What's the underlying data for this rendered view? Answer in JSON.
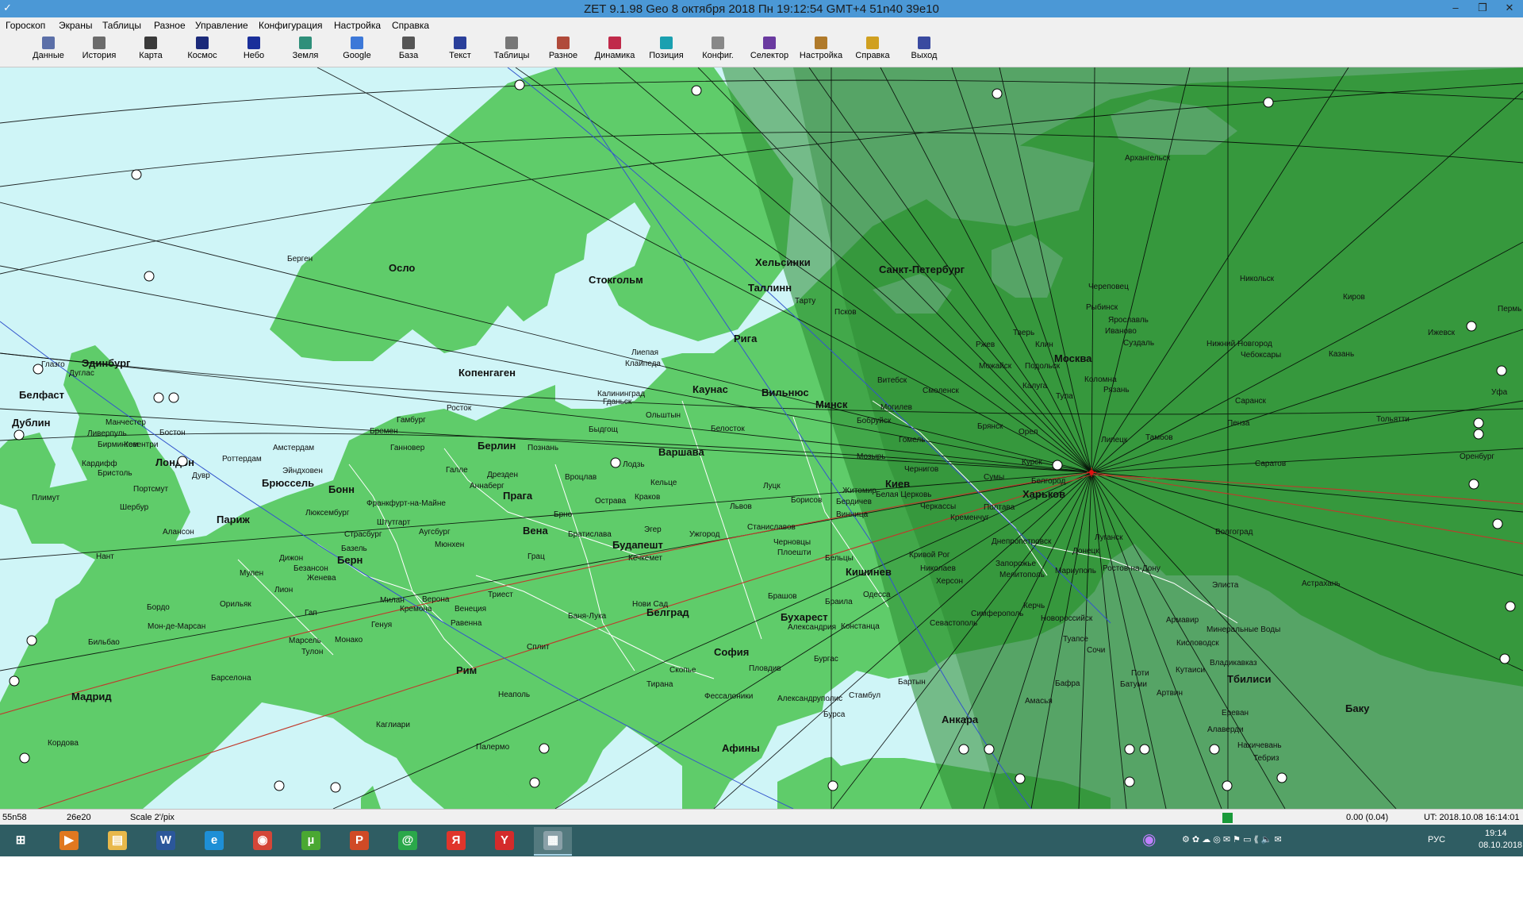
{
  "window": {
    "title": "ZET 9.1.98 Geo     8 октября 2018  Пн   19:12:54 GMT+4 51n40  39e10",
    "controls": [
      "–",
      "❐",
      "✕"
    ]
  },
  "menu": [
    "Гороскоп",
    "Экраны",
    "Таблицы",
    "Разное",
    "Управление",
    "Конфигурация",
    "Настройка",
    "Справка"
  ],
  "toolbar": [
    {
      "label": "Данные",
      "icon": "data-icon",
      "color": "#5b6fa8"
    },
    {
      "label": "История",
      "icon": "history-icon",
      "color": "#6b6b6b"
    },
    {
      "label": "Карта",
      "icon": "map-icon",
      "color": "#3a3a3a"
    },
    {
      "label": "Космос",
      "icon": "cosmos-icon",
      "color": "#1b2a7a"
    },
    {
      "label": "Небо",
      "icon": "sky-icon",
      "color": "#1a2f9a"
    },
    {
      "label": "Земля",
      "icon": "earth-icon",
      "color": "#2f8f7a"
    },
    {
      "label": "Google",
      "icon": "google-icon",
      "color": "#3c78d8"
    },
    {
      "label": "База",
      "icon": "database-icon",
      "color": "#555555"
    },
    {
      "label": "Текст",
      "icon": "text-icon",
      "color": "#2a3f9a"
    },
    {
      "label": "Таблицы",
      "icon": "tables-icon",
      "color": "#777777"
    },
    {
      "label": "Разное",
      "icon": "misc-icon",
      "color": "#b04a3a"
    },
    {
      "label": "Динамика",
      "icon": "dynamics-icon",
      "color": "#c02a4a"
    },
    {
      "label": "Позиция",
      "icon": "position-icon",
      "color": "#1aa0b0"
    },
    {
      "label": "Конфиг.",
      "icon": "config-icon",
      "color": "#888888"
    },
    {
      "label": "Селектор",
      "icon": "selector-icon",
      "color": "#6a3aa0"
    },
    {
      "label": "Настройка",
      "icon": "settings-icon",
      "color": "#b07a2a"
    },
    {
      "label": "Справка",
      "icon": "help-icon",
      "color": "#d0a020"
    },
    {
      "label": "Выход",
      "icon": "exit-icon",
      "color": "#3a4aa0"
    }
  ],
  "map": {
    "colors": {
      "sea": "#cff5f7",
      "land": "#5fcc6a",
      "land_shaded": "#2f9934",
      "land_dark": "#238a2c",
      "sea_shaded": "#a7d6d8",
      "line": "#000000",
      "ecliptic": "#c0392b",
      "equator": "#3355cc"
    },
    "cities": [
      {
        "name": "Архангельск",
        "b": false
      },
      {
        "name": "Берген",
        "b": false
      },
      {
        "name": "Осло",
        "b": true
      },
      {
        "name": "Стокгольм",
        "b": true
      },
      {
        "name": "Хельсинки",
        "b": true
      },
      {
        "name": "Санкт-Петербург",
        "b": true
      },
      {
        "name": "Таллинн",
        "b": true
      },
      {
        "name": "Тарту",
        "b": false
      },
      {
        "name": "Псков",
        "b": false
      },
      {
        "name": "Череповец",
        "b": false
      },
      {
        "name": "Никольск",
        "b": false
      },
      {
        "name": "Киров",
        "b": false
      },
      {
        "name": "Пермь",
        "b": false
      },
      {
        "name": "Рыбинск",
        "b": false
      },
      {
        "name": "Ярославль",
        "b": false
      },
      {
        "name": "Иваново",
        "b": false
      },
      {
        "name": "Эдинбург",
        "b": true
      },
      {
        "name": "Глазго",
        "b": false
      },
      {
        "name": "Дуглас",
        "b": false
      },
      {
        "name": "Белфаст",
        "b": true
      },
      {
        "name": "Дублин",
        "b": true
      },
      {
        "name": "Копенгаген",
        "b": true
      },
      {
        "name": "Рига",
        "b": true
      },
      {
        "name": "Лиепая",
        "b": false
      },
      {
        "name": "Клайпеда",
        "b": false
      },
      {
        "name": "Каунас",
        "b": true
      },
      {
        "name": "Вильнюс",
        "b": true
      },
      {
        "name": "Калининград",
        "b": false
      },
      {
        "name": "Гданьск",
        "b": false
      },
      {
        "name": "Тверь",
        "b": false
      },
      {
        "name": "Ржев",
        "b": false
      },
      {
        "name": "Клин",
        "b": false
      },
      {
        "name": "Суздаль",
        "b": false
      },
      {
        "name": "Нижний Новгород",
        "b": false
      },
      {
        "name": "Чебоксары",
        "b": false
      },
      {
        "name": "Ижевск",
        "b": false
      },
      {
        "name": "Казань",
        "b": false
      },
      {
        "name": "Москва",
        "b": true
      },
      {
        "name": "Подольск",
        "b": false
      },
      {
        "name": "Можайск",
        "b": false
      },
      {
        "name": "Коломна",
        "b": false
      },
      {
        "name": "Рязань",
        "b": false
      },
      {
        "name": "Калуга",
        "b": false
      },
      {
        "name": "Тула",
        "b": false
      },
      {
        "name": "Смоленск",
        "b": false
      },
      {
        "name": "Витебск",
        "b": false
      },
      {
        "name": "Минск",
        "b": true
      },
      {
        "name": "Могилев",
        "b": false
      },
      {
        "name": "Бобруйск",
        "b": false
      },
      {
        "name": "Брянск",
        "b": false
      },
      {
        "name": "Орел",
        "b": false
      },
      {
        "name": "Липецк",
        "b": false
      },
      {
        "name": "Тамбов",
        "b": false
      },
      {
        "name": "Саранск",
        "b": false
      },
      {
        "name": "Пенза",
        "b": false
      },
      {
        "name": "Тольятти",
        "b": false
      },
      {
        "name": "Уфа",
        "b": false
      },
      {
        "name": "Оренбург",
        "b": false
      },
      {
        "name": "Саратов",
        "b": false
      },
      {
        "name": "Курск",
        "b": false
      },
      {
        "name": "Белгород",
        "b": false
      },
      {
        "name": "Сумы",
        "b": false
      },
      {
        "name": "Гомель",
        "b": false
      },
      {
        "name": "Мозырь",
        "b": false
      },
      {
        "name": "Чернигов",
        "b": false
      },
      {
        "name": "Киев",
        "b": true
      },
      {
        "name": "Харьков",
        "b": true
      },
      {
        "name": "Полтава",
        "b": false
      },
      {
        "name": "Кременчуг",
        "b": false
      },
      {
        "name": "Черкассы",
        "b": false
      },
      {
        "name": "Белая Церковь",
        "b": false
      },
      {
        "name": "Житомир",
        "b": false
      },
      {
        "name": "Бердичев",
        "b": false
      },
      {
        "name": "Винница",
        "b": false
      },
      {
        "name": "Манчестер",
        "b": false
      },
      {
        "name": "Ливерпуль",
        "b": false
      },
      {
        "name": "Бирмингем",
        "b": false
      },
      {
        "name": "Ковентри",
        "b": false
      },
      {
        "name": "Бостон",
        "b": false
      },
      {
        "name": "Кардифф",
        "b": false
      },
      {
        "name": "Бристоль",
        "b": false
      },
      {
        "name": "Лондон",
        "b": true
      },
      {
        "name": "Дувр",
        "b": false
      },
      {
        "name": "Портсмут",
        "b": false
      },
      {
        "name": "Плимут",
        "b": false
      },
      {
        "name": "Шербур",
        "b": false
      },
      {
        "name": "Роттердам",
        "b": false
      },
      {
        "name": "Амстердам",
        "b": false
      },
      {
        "name": "Эйндховен",
        "b": false
      },
      {
        "name": "Брюссель",
        "b": true
      },
      {
        "name": "Бремен",
        "b": false
      },
      {
        "name": "Гамбург",
        "b": false
      },
      {
        "name": "Росток",
        "b": false
      },
      {
        "name": "Ганновер",
        "b": false
      },
      {
        "name": "Берлин",
        "b": true
      },
      {
        "name": "Познань",
        "b": false
      },
      {
        "name": "Быдгощ",
        "b": false
      },
      {
        "name": "Ольштын",
        "b": false
      },
      {
        "name": "Белосток",
        "b": false
      },
      {
        "name": "Варшава",
        "b": true
      },
      {
        "name": "Лодзь",
        "b": false
      },
      {
        "name": "Кельце",
        "b": false
      },
      {
        "name": "Краков",
        "b": false
      },
      {
        "name": "Вроцлав",
        "b": false
      },
      {
        "name": "Дрезден",
        "b": false
      },
      {
        "name": "Галле",
        "b": false
      },
      {
        "name": "Аннаберг",
        "b": false
      },
      {
        "name": "Прага",
        "b": true
      },
      {
        "name": "Брно",
        "b": false
      },
      {
        "name": "Острава",
        "b": false
      },
      {
        "name": "Бонн",
        "b": true
      },
      {
        "name": "Франкфурт-на-Майне",
        "b": false
      },
      {
        "name": "Люксембург",
        "b": false
      },
      {
        "name": "Штутгарт",
        "b": false
      },
      {
        "name": "Аугсбург",
        "b": false
      },
      {
        "name": "Страсбург",
        "b": false
      },
      {
        "name": "Мюнхен",
        "b": false
      },
      {
        "name": "Базель",
        "b": false
      },
      {
        "name": "Берн",
        "b": true
      },
      {
        "name": "Дижон",
        "b": false
      },
      {
        "name": "Безансон",
        "b": false
      },
      {
        "name": "Мулен",
        "b": false
      },
      {
        "name": "Женева",
        "b": false
      },
      {
        "name": "Лион",
        "b": false
      },
      {
        "name": "Париж",
        "b": true
      },
      {
        "name": "Алансон",
        "b": false
      },
      {
        "name": "Нант",
        "b": false
      },
      {
        "name": "Орильяк",
        "b": false
      },
      {
        "name": "Бордо",
        "b": false
      },
      {
        "name": "Мон-де-Марсан",
        "b": false
      },
      {
        "name": "Гап",
        "b": false
      },
      {
        "name": "Марсель",
        "b": false
      },
      {
        "name": "Монако",
        "b": false
      },
      {
        "name": "Тулон",
        "b": false
      },
      {
        "name": "Бильбао",
        "b": false
      },
      {
        "name": "Барселона",
        "b": false
      },
      {
        "name": "Мадрид",
        "b": true
      },
      {
        "name": "Кордова",
        "b": false
      },
      {
        "name": "Вена",
        "b": true
      },
      {
        "name": "Братислава",
        "b": false
      },
      {
        "name": "Будапешт",
        "b": true
      },
      {
        "name": "Эгер",
        "b": false
      },
      {
        "name": "Кечкемет",
        "b": false
      },
      {
        "name": "Грац",
        "b": false
      },
      {
        "name": "Милан",
        "b": false
      },
      {
        "name": "Верона",
        "b": false
      },
      {
        "name": "Кремона",
        "b": false
      },
      {
        "name": "Венеция",
        "b": false
      },
      {
        "name": "Триест",
        "b": false
      },
      {
        "name": "Генуя",
        "b": false
      },
      {
        "name": "Равенна",
        "b": false
      },
      {
        "name": "Баня-Лука",
        "b": false
      },
      {
        "name": "Нови Сад",
        "b": false
      },
      {
        "name": "Белград",
        "b": true
      },
      {
        "name": "Сплит",
        "b": false
      },
      {
        "name": "Рим",
        "b": true
      },
      {
        "name": "Неаполь",
        "b": false
      },
      {
        "name": "Каглиари",
        "b": false
      },
      {
        "name": "Палермо",
        "b": false
      },
      {
        "name": "Скопье",
        "b": false
      },
      {
        "name": "Тирана",
        "b": false
      },
      {
        "name": "Фессалоники",
        "b": false
      },
      {
        "name": "Афины",
        "b": true
      },
      {
        "name": "София",
        "b": true
      },
      {
        "name": "Пловдив",
        "b": false
      },
      {
        "name": "Бургас",
        "b": false
      },
      {
        "name": "Александрия",
        "b": false
      },
      {
        "name": "Бухарест",
        "b": true
      },
      {
        "name": "Констанца",
        "b": false
      },
      {
        "name": "Брашов",
        "b": false
      },
      {
        "name": "Браила",
        "b": false
      },
      {
        "name": "Львов",
        "b": false
      },
      {
        "name": "Ужгород",
        "b": false
      },
      {
        "name": "Станиславов",
        "b": false
      },
      {
        "name": "Луцк",
        "b": false
      },
      {
        "name": "Борисов",
        "b": false
      },
      {
        "name": "Черновцы",
        "b": false
      },
      {
        "name": "Плоешти",
        "b": false
      },
      {
        "name": "Бельцы",
        "b": false
      },
      {
        "name": "Кишинев",
        "b": true
      },
      {
        "name": "Одесса",
        "b": false
      },
      {
        "name": "Кривой Рог",
        "b": false
      },
      {
        "name": "Николаев",
        "b": false
      },
      {
        "name": "Херсон",
        "b": false
      },
      {
        "name": "Днепропетровск",
        "b": false
      },
      {
        "name": "Запорожье",
        "b": false
      },
      {
        "name": "Мелитополь",
        "b": false
      },
      {
        "name": "Мариуполь",
        "b": false
      },
      {
        "name": "Донецк",
        "b": false
      },
      {
        "name": "Луганск",
        "b": false
      },
      {
        "name": "Ростов-на-Дону",
        "b": false
      },
      {
        "name": "Волгоград",
        "b": false
      },
      {
        "name": "Элиста",
        "b": false
      },
      {
        "name": "Астрахань",
        "b": false
      },
      {
        "name": "Севастополь",
        "b": false
      },
      {
        "name": "Симферополь",
        "b": false
      },
      {
        "name": "Керчь",
        "b": false
      },
      {
        "name": "Новороссийск",
        "b": false
      },
      {
        "name": "Армавир",
        "b": false
      },
      {
        "name": "Минеральные Воды",
        "b": false
      },
      {
        "name": "Кисловодск",
        "b": false
      },
      {
        "name": "Туапсе",
        "b": false
      },
      {
        "name": "Сочи",
        "b": false
      },
      {
        "name": "Владикавказ",
        "b": false
      },
      {
        "name": "Кутаиси",
        "b": false
      },
      {
        "name": "Тбилиси",
        "b": true
      },
      {
        "name": "Поти",
        "b": false
      },
      {
        "name": "Батуми",
        "b": false
      },
      {
        "name": "Артвин",
        "b": false
      },
      {
        "name": "Ереван",
        "b": false
      },
      {
        "name": "Алаверди",
        "b": false
      },
      {
        "name": "Нахичевань",
        "b": false
      },
      {
        "name": "Тебриз",
        "b": false
      },
      {
        "name": "Баку",
        "b": true
      },
      {
        "name": "Анкара",
        "b": true
      },
      {
        "name": "Бартын",
        "b": false
      },
      {
        "name": "Стамбул",
        "b": false
      },
      {
        "name": "Бурса",
        "b": false
      },
      {
        "name": "Александруполис",
        "b": false
      },
      {
        "name": "Бафра",
        "b": false
      },
      {
        "name": "Амасья",
        "b": false
      }
    ]
  },
  "status": {
    "lat": "55n58",
    "lon": "26e20",
    "scale": "Scale 2'/pix",
    "value": "0.00 (0.04)",
    "ut": "UT: 2018.10.08 16:14:01"
  },
  "taskbar": {
    "apps": [
      {
        "name": "start",
        "glyph": "⊞",
        "color": "#2f5d63"
      },
      {
        "name": "media-player",
        "glyph": "▶",
        "color": "#e07820"
      },
      {
        "name": "file-explorer",
        "glyph": "▤",
        "color": "#e8b84a"
      },
      {
        "name": "word",
        "glyph": "W",
        "color": "#2b579a"
      },
      {
        "name": "internet-explorer",
        "glyph": "e",
        "color": "#1e8fd6"
      },
      {
        "name": "chrome",
        "glyph": "◉",
        "color": "#d44638"
      },
      {
        "name": "utorrent",
        "glyph": "µ",
        "color": "#4aa832"
      },
      {
        "name": "powerpoint",
        "glyph": "P",
        "color": "#d04a26"
      },
      {
        "name": "mail-agent",
        "glyph": "@",
        "color": "#2aa84a"
      },
      {
        "name": "yandex",
        "glyph": "Я",
        "color": "#e0352b"
      },
      {
        "name": "yandex-browser",
        "glyph": "Y",
        "color": "#d42b2b"
      },
      {
        "name": "zet",
        "glyph": "▦",
        "color": "#8aa0a8"
      }
    ],
    "lang": "РУС",
    "time": "19:14",
    "date": "08.10.2018"
  }
}
